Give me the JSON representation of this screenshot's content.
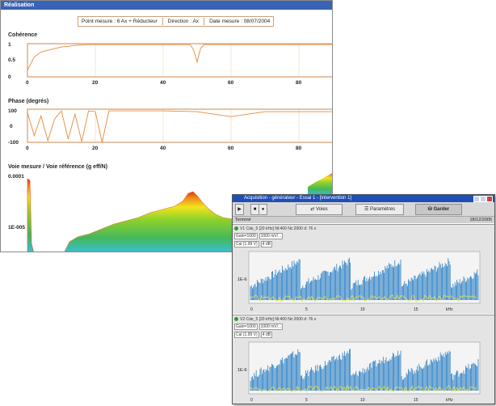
{
  "realisation_window": {
    "title": "Réalisation",
    "info": {
      "point_mesure": "Point mesure : 6 Ax + Réducteur",
      "direction": "Direction : Ax",
      "date_mesure": "Date mesure : 08/07/2004"
    }
  },
  "acquisition_window": {
    "title": "Acquisition - générateur - Essai 1 - [intervention 1]",
    "toolbar": {
      "voies_label": "Voies",
      "parametres_label": "Paramètres",
      "garder_label": "Garder"
    },
    "status": {
      "left": "Terminé",
      "right": "18/12/2005"
    },
    "channels": [
      {
        "header": "V1 Cde_5 [20 kHz] Nl:400 Nc:2000 d: 76 s",
        "gain": "Gain=1000",
        "range": "1000 mV/...",
        "cal": "Cal (1.99 V)",
        "cal_db": "4 dB",
        "ylabel": "1E-6",
        "xticks": [
          "0",
          "5",
          "10",
          "15",
          "kHz"
        ]
      },
      {
        "header": "V2 Cde_5 [20 kHz] Nl:400 Nc:2000 d: 76 s",
        "gain": "Gain=1000",
        "range": "1000 mV/...",
        "cal": "Cal (1.99 V)",
        "cal_db": "4 dB",
        "ylabel": "1E-6",
        "xticks": [
          "0",
          "5",
          "10",
          "15",
          "kHz"
        ]
      }
    ]
  },
  "chart_data": [
    {
      "type": "line",
      "title": "Cohérence",
      "ylim": [
        0,
        1
      ],
      "yticks": [
        "1",
        "0.5",
        "0"
      ],
      "xticks": [
        "0",
        "20",
        "40",
        "60",
        "80"
      ],
      "x": [
        0,
        2,
        4,
        6,
        8,
        10,
        12,
        14,
        16,
        18,
        20,
        30,
        40,
        48,
        49,
        50,
        51,
        52,
        60,
        70,
        80,
        90
      ],
      "values": [
        0.2,
        0.6,
        0.75,
        0.8,
        0.85,
        0.9,
        0.92,
        0.95,
        0.96,
        0.97,
        0.97,
        0.97,
        0.97,
        0.97,
        0.8,
        0.45,
        0.85,
        0.97,
        0.97,
        0.97,
        0.97,
        0.97
      ]
    },
    {
      "type": "line",
      "title": "Phase (degrés)",
      "ylim": [
        -100,
        100
      ],
      "yticks": [
        "100",
        "0",
        "-100"
      ],
      "xticks": [
        "0",
        "20",
        "40",
        "60",
        "80"
      ],
      "x": [
        0,
        2,
        4,
        6,
        8,
        10,
        12,
        14,
        16,
        18,
        20,
        22,
        24,
        30,
        40,
        50,
        55,
        60,
        65,
        70,
        80,
        90
      ],
      "values": [
        80,
        -60,
        60,
        -90,
        40,
        90,
        -80,
        70,
        -95,
        90,
        85,
        -100,
        90,
        90,
        90,
        85,
        70,
        55,
        70,
        85,
        85,
        85
      ]
    },
    {
      "type": "area",
      "title": "Voie mesure / Voie référence (g eff/N)",
      "ylim": [
        1e-07,
        0.0001
      ],
      "yticks": [
        "0.0001",
        "1E-005"
      ]
    }
  ]
}
